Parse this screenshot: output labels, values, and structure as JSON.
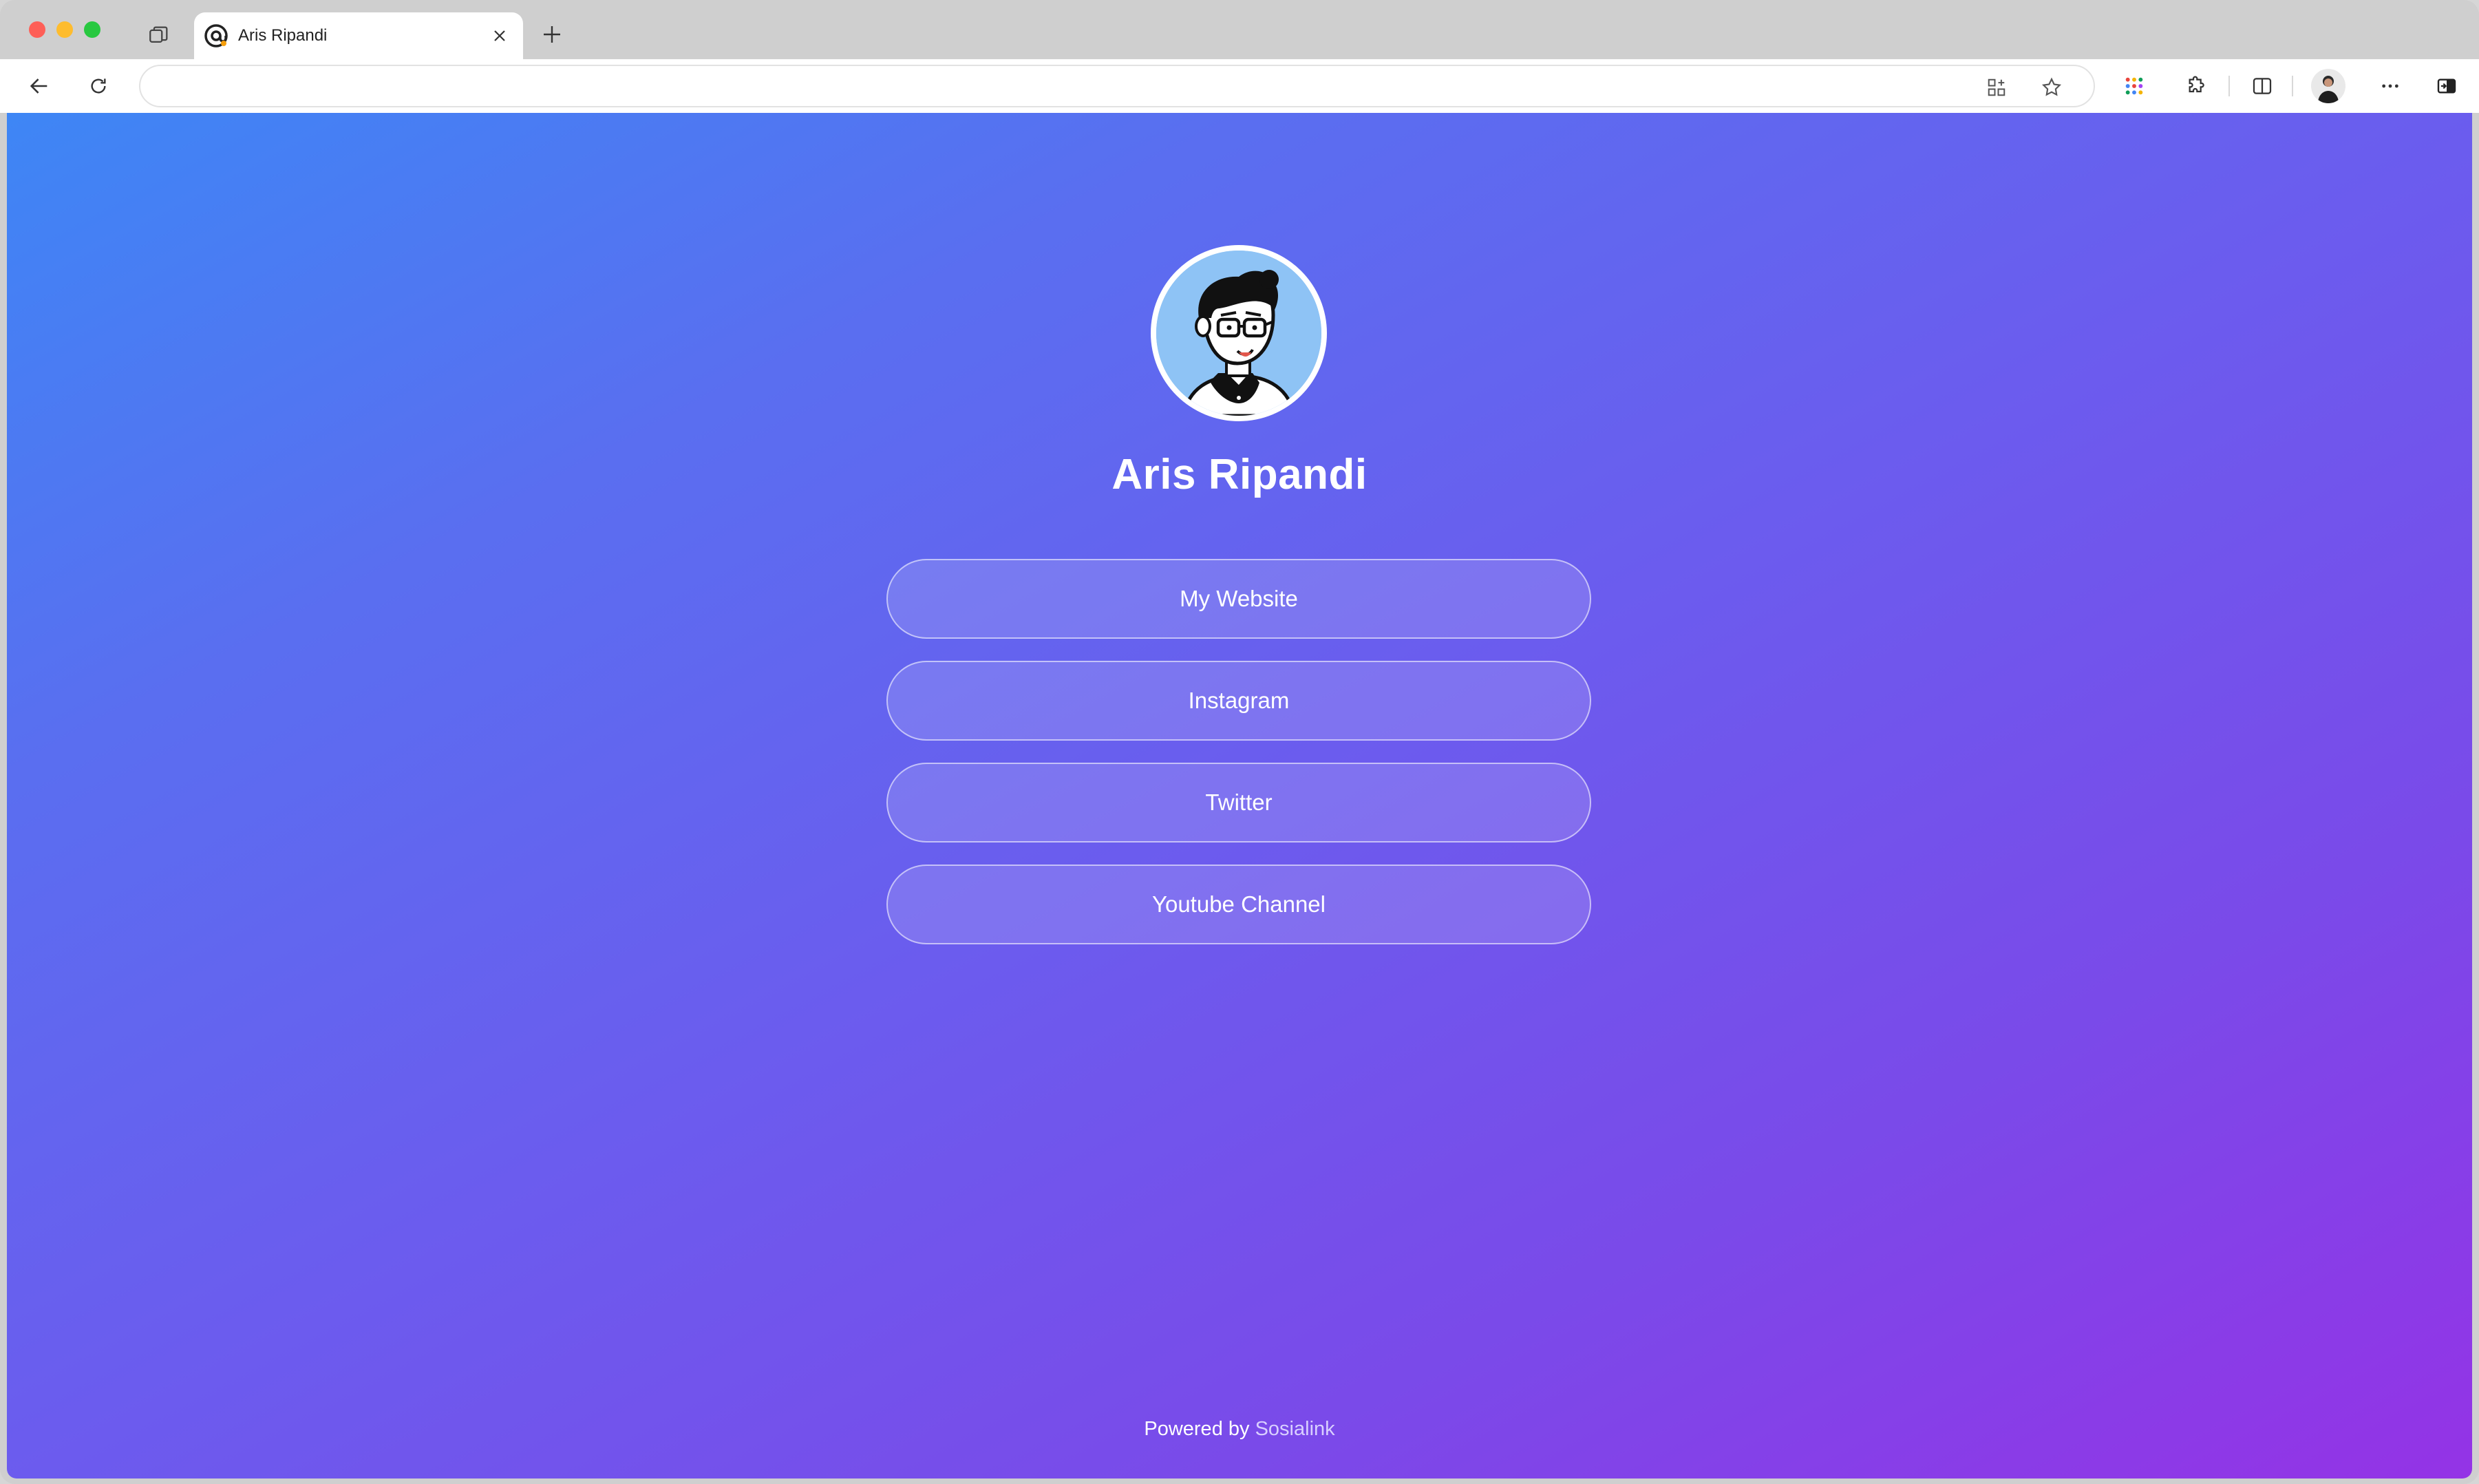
{
  "browser": {
    "tab_title": "Aris Ripandi",
    "address_value": ""
  },
  "profile": {
    "name": "Aris Ripandi"
  },
  "links": [
    {
      "label": "My Website"
    },
    {
      "label": "Instagram"
    },
    {
      "label": "Twitter"
    },
    {
      "label": "Youtube Channel"
    }
  ],
  "footer": {
    "prefix": "Powered by",
    "brand": "Sosialink"
  },
  "icons": {
    "tab_actions": "tab-actions-icon",
    "favicon": "sosialink-favicon-icon",
    "close": "close-icon",
    "new_tab": "plus-icon",
    "back": "back-arrow-icon",
    "refresh": "refresh-icon",
    "app_grid": "app-grid-icon",
    "favorite": "star-icon",
    "apps": "apps-launcher-icon",
    "extensions": "puzzle-icon",
    "split_screen": "split-screen-icon",
    "more": "more-icon",
    "sidebar": "sidebar-toggle-icon"
  },
  "colors": {
    "gradient_start": "#3e86f5",
    "gradient_end": "#9433e6",
    "brand_link": "#d9cfff"
  }
}
